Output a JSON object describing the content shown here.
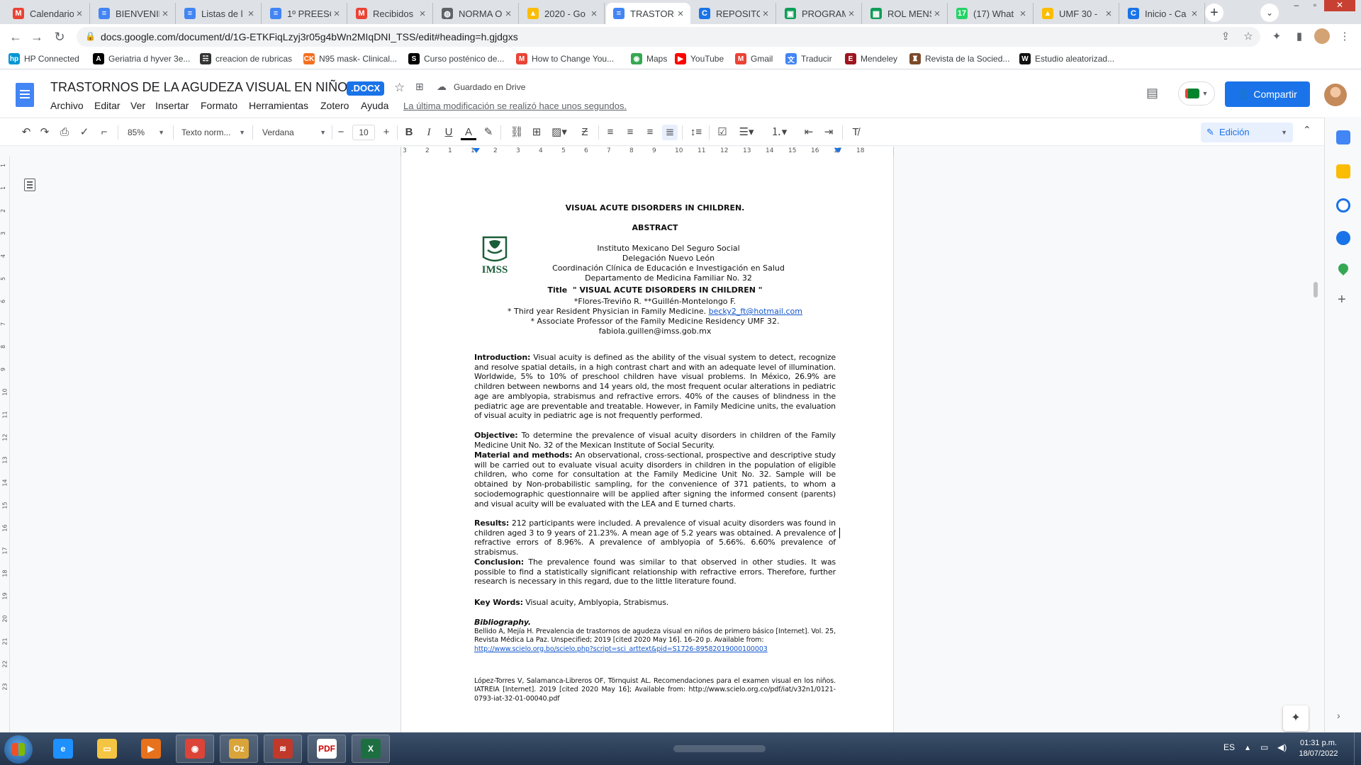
{
  "browser": {
    "tabs": [
      {
        "label": "Calendario",
        "icon": "gmail-icon",
        "color": "#ea4335",
        "glyph": "M"
      },
      {
        "label": "BIENVENID",
        "icon": "docs-icon",
        "color": "#4285f4",
        "glyph": "≡"
      },
      {
        "label": "Listas de l",
        "icon": "docs-icon",
        "color": "#4285f4",
        "glyph": "≡"
      },
      {
        "label": "1º PREESC",
        "icon": "docs-icon",
        "color": "#4285f4",
        "glyph": "≡"
      },
      {
        "label": "Recibidos",
        "icon": "gmail-icon",
        "color": "#ea4335",
        "glyph": "M"
      },
      {
        "label": "NORMA O",
        "icon": "globe-icon",
        "color": "#5f6368",
        "glyph": "◍"
      },
      {
        "label": "2020 - Go",
        "icon": "drive-icon",
        "color": "#fbbc04",
        "glyph": "▲"
      },
      {
        "label": "TRASTORN",
        "icon": "docs-icon",
        "color": "#4285f4",
        "glyph": "≡"
      },
      {
        "label": "REPOSITO",
        "icon": "chrome-page-icon",
        "color": "#1a73e8",
        "glyph": "C"
      },
      {
        "label": "PROGRAM",
        "icon": "classroom-icon",
        "color": "#0f9d58",
        "glyph": "▣"
      },
      {
        "label": "ROL MENS",
        "icon": "sheets-icon",
        "color": "#0f9d58",
        "glyph": "▦"
      },
      {
        "label": "(17) What",
        "icon": "whatsapp-icon",
        "color": "#25d366",
        "glyph": "17"
      },
      {
        "label": "UMF 30 - ",
        "icon": "drive-icon",
        "color": "#fbbc04",
        "glyph": "▲"
      },
      {
        "label": "Inicio - Ca",
        "icon": "chrome-page-icon",
        "color": "#1a73e8",
        "glyph": "C"
      }
    ],
    "new_tab": "+",
    "url": "docs.google.com/document/d/1G-ETKFiqLzyj3r05g4bWn2MIqDNI_TSS/edit#heading=h.gjdgxs",
    "bookmarks": [
      {
        "label": "HP Connected",
        "color": "#0096d6",
        "glyph": "hp"
      },
      {
        "label": "Geriatria d hyver 3e...",
        "color": "#000000",
        "glyph": "A"
      },
      {
        "label": "creacion de rubricas",
        "color": "#333333",
        "glyph": "☵"
      },
      {
        "label": "N95 mask- Clinical...",
        "color": "#f37021",
        "glyph": "CK"
      },
      {
        "label": "Curso posténico de...",
        "color": "#000000",
        "glyph": "S"
      },
      {
        "label": "How to Change You...",
        "color": "#ea4335",
        "glyph": "M"
      },
      {
        "label": "Maps",
        "color": "#34a853",
        "glyph": "◉"
      },
      {
        "label": "YouTube",
        "color": "#ff0000",
        "glyph": "▶"
      },
      {
        "label": "Gmail",
        "color": "#ea4335",
        "glyph": "M"
      },
      {
        "label": "Traducir",
        "color": "#4285f4",
        "glyph": "文"
      },
      {
        "label": "Mendeley",
        "color": "#9d1620",
        "glyph": "E"
      },
      {
        "label": "Revista de la Socied...",
        "color": "#7b4a2a",
        "glyph": "♜"
      },
      {
        "label": "Estudio aleatorizad...",
        "color": "#111111",
        "glyph": "W"
      }
    ]
  },
  "docs": {
    "title": "TRASTORNOS DE  LA AGUDEZA VISUAL EN NIÑOS",
    "badge": ".DOCX",
    "saved": "Guardado en Drive",
    "menus": [
      "Archivo",
      "Editar",
      "Ver",
      "Insertar",
      "Formato",
      "Herramientas",
      "Zotero",
      "Ayuda"
    ],
    "last_edit": "La última modificación se realizó hace unos segundos.",
    "share": "Compartir",
    "toolbar": {
      "zoom": "85%",
      "style": "Texto norm...",
      "font": "Verdana",
      "font_size": "10",
      "mode": "Edición"
    },
    "ruler_numbers": [
      "3",
      "2",
      "1",
      "1",
      "2",
      "3",
      "4",
      "5",
      "6",
      "7",
      "8",
      "9",
      "10",
      "11",
      "12",
      "13",
      "14",
      "15",
      "16",
      "17",
      "18"
    ],
    "vruler_numbers": [
      "1",
      "1",
      "2",
      "3",
      "4",
      "5",
      "6",
      "7",
      "8",
      "9",
      "10",
      "11",
      "12",
      "13",
      "14",
      "15",
      "16",
      "17",
      "18",
      "19",
      "20",
      "21",
      "22",
      "23"
    ]
  },
  "document": {
    "heading": "VISUAL ACUTE DISORDERS IN CHILDREN.",
    "abstract_label": "ABSTRACT",
    "logo_text": "IMSS",
    "institution": [
      "Instituto Mexicano Del Seguro Social",
      "Delegación Nuevo León",
      "Coordinación Clínica de Educación e Investigación en Salud",
      "Departamento de Medicina Familiar No. 32"
    ],
    "title_label": "Title",
    "title_value": "\" VISUAL ACUTE DISORDERS IN CHILDREN \"",
    "authors": "*Flores-Treviño R. **Guillén-Montelongo F.",
    "affiliation1_text": "* Third year Resident Physician in Family Medicine.",
    "affiliation1_email": "becky2_ft@hotmail.com",
    "affiliation2": "* Associate Professor of the Family Medicine Residency UMF 32.",
    "affiliation2_email": "fabiola.guillen@imss.gob.mx",
    "intro_label": "Introduction:",
    "intro_text": " Visual acuity is defined as the ability of the visual system to detect, recognize and resolve spatial details, in a high contrast chart and with an adequate level of illumination. Worldwide, 5% to 10% of preschool children have visual problems. In México, 26.9% are children between newborns and 14 years old, the most frequent ocular alterations in pediatric age are amblyopia, strabismus and refractive errors. 40% of the causes of blindness in the pediatric age are preventable and treatable. However, in Family Medicine units, the evaluation of visual acuity in pediatric age is not frequently performed.",
    "objective_label": "Objective:",
    "objective_text": " To determine the prevalence of visual acuity disorders in children of the Family Medicine Unit No. 32 of the Mexican Institute of Social Security.",
    "methods_label": "Material and methods:",
    "methods_text": " An observational, cross-sectional, prospective and descriptive study will be carried out to evaluate visual acuity disorders in children in the population of eligible children, who come for consultation at the Family Medicine Unit No. 32. Sample will be obtained by Non-probabilistic sampling, for the convenience of 371 patients, to whom a sociodemographic questionnaire will be applied after signing the informed consent (parents) and visual acuity will be evaluated with the LEA and E turned charts.",
    "results_label": "Results:",
    "results_text": "  212 participants were included. A prevalence of visual acuity disorders was found in children aged 3 to 9 years of 21.23%. A mean age of 5.2 years was obtained. A prevalence of refractive errors of 8.96%. A prevalence of amblyopia of 5.66%. 6.60% prevalence of strabismus.",
    "conclusion_label": "Conclusion:",
    "conclusion_text": " The prevalence found was similar to that observed in other studies. It was possible to find a statistically significant relationship with refractive errors. Therefore, further research is necessary in this regard, due to the little literature found.",
    "keywords_label": "Key Words:",
    "keywords_text": " Visual acuity, Amblyopia, Strabismus.",
    "bibliography_label": "Bibliography.",
    "bib1_text": "Bellido A, Mejía H. Prevalencia de trastornos de agudeza visual en niños de primero básico [Internet]. Vol. 25, Revista Médica La Paz. Unspecified; 2019 [cited 2020 May 16]. 16–20 p. Available from:",
    "bib1_link": "http://www.scielo.org.bo/scielo.php?script=sci_arttext&pid=S1726-89582019000100003",
    "bib2_text": "López-Torres V, Salamanca-Libreros OF, Törnquist AL. Recomendaciones para el examen visual en los niños. IATREIA [Internet]. 2019 [cited 2020 May 16]; Available from: http://www.scielo.org.co/pdf/iat/v32n1/0121-0793-iat-32-01-00040.pdf"
  },
  "taskbar": {
    "language": "ES",
    "time": "01:31 p.m.",
    "date": "18/07/2022",
    "apps": [
      {
        "name": "internet-explorer-icon",
        "color": "#1e90ff",
        "glyph": "e"
      },
      {
        "name": "file-explorer-icon",
        "color": "#f4c542",
        "glyph": "▭"
      },
      {
        "name": "media-player-icon",
        "color": "#e8711c",
        "glyph": "▶"
      },
      {
        "name": "chrome-icon",
        "color": "#db4437",
        "glyph": "◉"
      },
      {
        "name": "outlook-icon",
        "color": "#d9a53a",
        "glyph": "Oz"
      },
      {
        "name": "colorful-app-icon",
        "color": "#c0392b",
        "glyph": "≋"
      },
      {
        "name": "pdf-icon",
        "color": "#ffffff",
        "glyph": "PDF"
      },
      {
        "name": "excel-icon",
        "color": "#1d6f42",
        "glyph": "X"
      }
    ]
  }
}
